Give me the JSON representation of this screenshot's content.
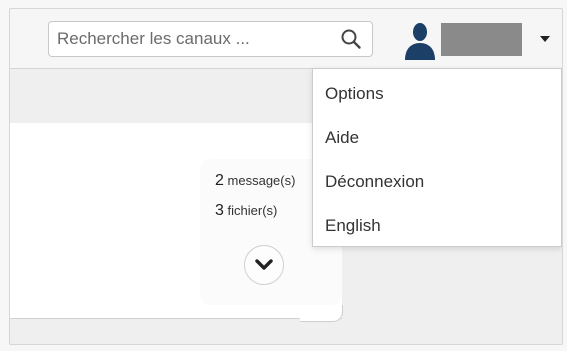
{
  "search": {
    "placeholder": "Rechercher les canaux ..."
  },
  "icons": {
    "search": "search-icon",
    "avatar": "user-avatar-icon",
    "caret": "chevron-down-icon",
    "expand": "chevron-down-icon"
  },
  "colors": {
    "avatar": "#1b3f66",
    "hidden_username": "#8a8a8a"
  },
  "user_menu": {
    "items": [
      {
        "label": "Options"
      },
      {
        "label": "Aide"
      },
      {
        "label": "Déconnexion"
      },
      {
        "label": "English"
      }
    ]
  },
  "channel_card": {
    "messages_count": "2",
    "messages_label": "message(s)",
    "files_count": "3",
    "files_label": "fichier(s)"
  }
}
